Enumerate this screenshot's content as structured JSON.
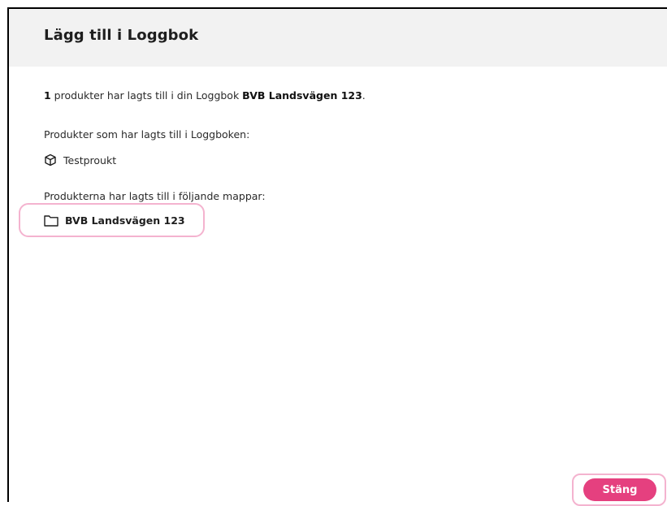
{
  "dialog": {
    "title": "Lägg till i Loggbok",
    "summary": {
      "count": "1",
      "text": " produkter har lagts till i din Loggbok ",
      "logbook_name": "BVB Landsvägen 123",
      "end": "."
    },
    "products_label": "Produkter som har lagts till i Loggboken:",
    "products": [
      {
        "icon": "package-icon",
        "name": "Testproukt"
      }
    ],
    "folders_label": "Produkterna har lagts till i följande mappar:",
    "folders": [
      {
        "icon": "folder-icon",
        "name": "BVB Landsvägen 123"
      }
    ],
    "close_label": "Stäng"
  },
  "colors": {
    "header_bg": "#f2f2f2",
    "primary_button": "#e5407f",
    "highlight_outline": "#f4b3cf"
  }
}
